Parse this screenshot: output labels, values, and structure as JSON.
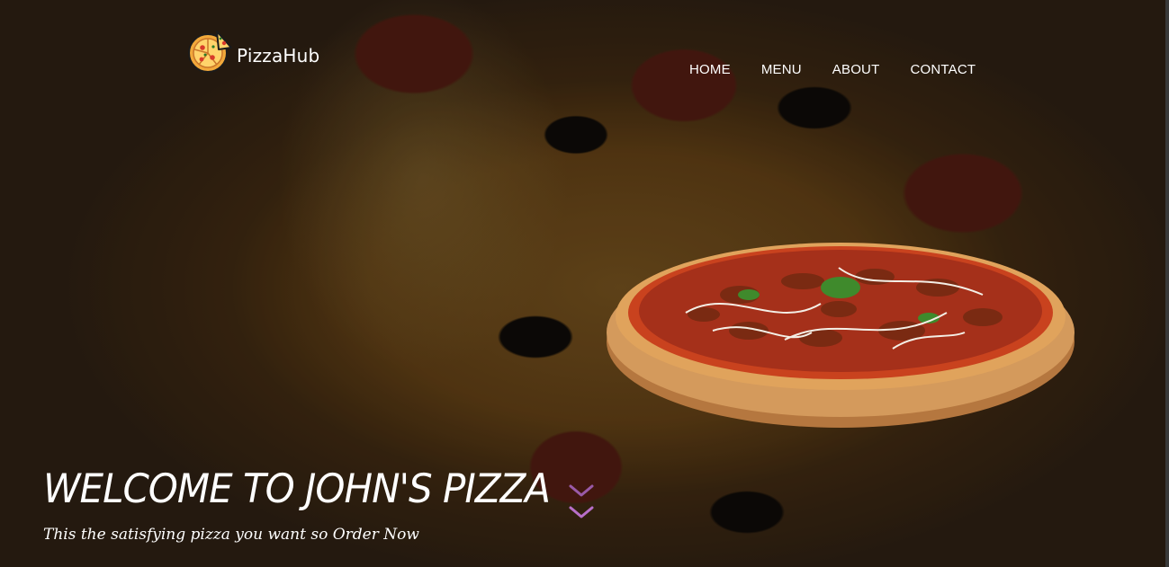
{
  "brand": {
    "name": "PizzaHub",
    "logo_icon": "pizza-icon"
  },
  "nav": {
    "items": [
      "HOME",
      "MENU",
      "ABOUT",
      "CONTACT"
    ]
  },
  "hero": {
    "title": "WELCOME TO JOHN'S PIZZA",
    "subtitle": "This the satisfying pizza you want so Order Now",
    "scroll_icon": "chevron-double-down-icon",
    "image": "pizza-on-wooden-board-image"
  },
  "colors": {
    "accent": "#b86fc9",
    "text": "#ffffff",
    "background": "#3a2a18"
  }
}
